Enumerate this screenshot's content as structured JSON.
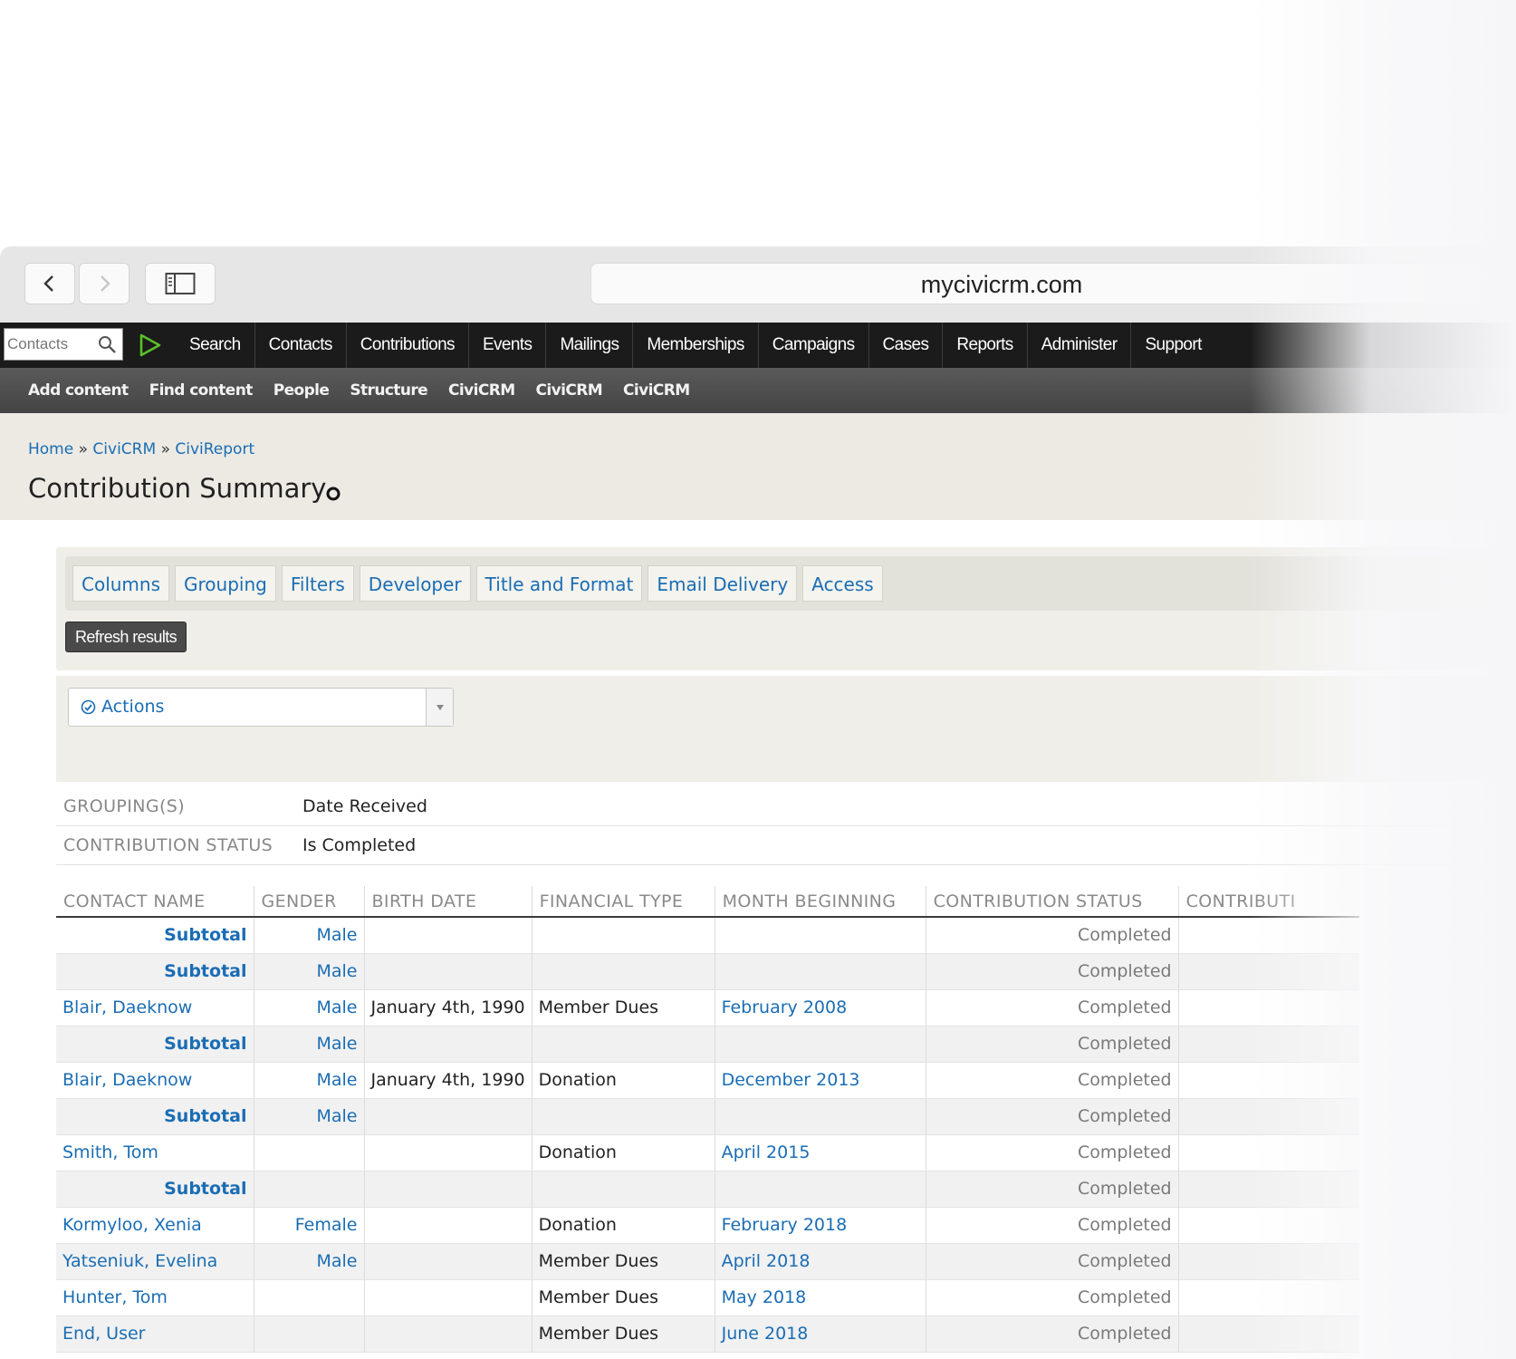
{
  "browser": {
    "url": "mycivicrm.com"
  },
  "civimenu": {
    "search_placeholder": "Contacts",
    "items": [
      "Search",
      "Contacts",
      "Contributions",
      "Events",
      "Mailings",
      "Memberships",
      "Campaigns",
      "Cases",
      "Reports",
      "Administer",
      "Support"
    ]
  },
  "admin_toolbar": {
    "items": [
      "Add content",
      "Find content",
      "People",
      "Structure",
      "CiviCRM",
      "CiviCRM",
      "CiviCRM"
    ]
  },
  "breadcrumb": {
    "home": "Home",
    "civicrm": "CiviCRM",
    "civireport": "CiviReport",
    "separator": "»"
  },
  "page_title": "Contribution Summary",
  "tabs": [
    "Columns",
    "Grouping",
    "Filters",
    "Developer",
    "Title and Format",
    "Email Delivery",
    "Access"
  ],
  "refresh_label": "Refresh results",
  "actions_label": "Actions",
  "statistics": [
    {
      "label": "GROUPING(S)",
      "value": "Date Received"
    },
    {
      "label": "CONTRIBUTION STATUS",
      "value": "Is Completed"
    }
  ],
  "table": {
    "columns": [
      "CONTACT NAME",
      "GENDER",
      "BIRTH DATE",
      "FINANCIAL TYPE",
      "MONTH BEGINNING",
      "CONTRIBUTION STATUS",
      "CONTRIBUTI"
    ],
    "rows": [
      {
        "name": "Subtotal",
        "subtotal": true,
        "gender": "Male",
        "birth_date": "",
        "financial_type": "",
        "month": "",
        "status": "Completed"
      },
      {
        "name": "Subtotal",
        "subtotal": true,
        "gender": "Male",
        "birth_date": "",
        "financial_type": "",
        "month": "",
        "status": "Completed"
      },
      {
        "name": "Blair, Daeknow",
        "subtotal": false,
        "gender": "Male",
        "birth_date": "January 4th, 1990",
        "financial_type": "Member Dues",
        "month": "February 2008",
        "status": "Completed"
      },
      {
        "name": "Subtotal",
        "subtotal": true,
        "gender": "Male",
        "birth_date": "",
        "financial_type": "",
        "month": "",
        "status": "Completed"
      },
      {
        "name": "Blair, Daeknow",
        "subtotal": false,
        "gender": "Male",
        "birth_date": "January 4th, 1990",
        "financial_type": "Donation",
        "month": "December 2013",
        "status": "Completed"
      },
      {
        "name": "Subtotal",
        "subtotal": true,
        "gender": "Male",
        "birth_date": "",
        "financial_type": "",
        "month": "",
        "status": "Completed"
      },
      {
        "name": "Smith, Tom",
        "subtotal": false,
        "gender": "",
        "birth_date": "",
        "financial_type": "Donation",
        "month": "April 2015",
        "status": "Completed"
      },
      {
        "name": "Subtotal",
        "subtotal": true,
        "gender": "",
        "birth_date": "",
        "financial_type": "",
        "month": "",
        "status": "Completed"
      },
      {
        "name": "Kormyloo, Xenia",
        "subtotal": false,
        "gender": "Female",
        "birth_date": "",
        "financial_type": "Donation",
        "month": "February 2018",
        "status": "Completed"
      },
      {
        "name": "Yatseniuk, Evelina",
        "subtotal": false,
        "gender": "Male",
        "birth_date": "",
        "financial_type": "Member Dues",
        "month": "April 2018",
        "status": "Completed"
      },
      {
        "name": "Hunter, Tom",
        "subtotal": false,
        "gender": "",
        "birth_date": "",
        "financial_type": "Member Dues",
        "month": "May 2018",
        "status": "Completed"
      },
      {
        "name": "End, User",
        "subtotal": false,
        "gender": "",
        "birth_date": "",
        "financial_type": "Member Dues",
        "month": "June 2018",
        "status": "Completed"
      }
    ]
  },
  "colors": {
    "link": "#1a6db4",
    "menu_bg": "#1b1b1b",
    "header_bg": "#eceae3",
    "civi_green": "#5bbf2a"
  }
}
